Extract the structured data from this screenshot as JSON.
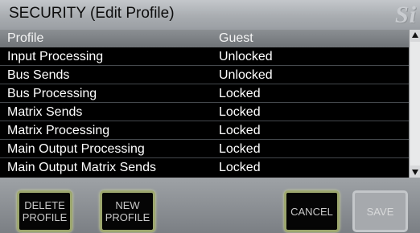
{
  "header": {
    "title": "SECURITY (Edit Profile)",
    "logo_text": "Si"
  },
  "table": {
    "header": {
      "col1": "Profile",
      "col2": "Guest"
    },
    "rows": [
      {
        "name": "Input Processing",
        "value": "Unlocked"
      },
      {
        "name": "Bus Sends",
        "value": "Unlocked"
      },
      {
        "name": "Bus Processing",
        "value": "Locked"
      },
      {
        "name": "Matrix Sends",
        "value": "Locked"
      },
      {
        "name": "Matrix Processing",
        "value": "Locked"
      },
      {
        "name": "Main Output Processing",
        "value": "Locked"
      },
      {
        "name": "Main Output Matrix Sends",
        "value": "Locked"
      }
    ]
  },
  "buttons": {
    "delete_line1": "DELETE",
    "delete_line2": "PROFILE",
    "new_line1": "NEW",
    "new_line2": "PROFILE",
    "cancel": "CANCEL",
    "save": "SAVE"
  },
  "colors": {
    "button_border": "#9ca66e",
    "header_bar": "#a9adb1",
    "row_text": "#ffffff"
  },
  "icons": {
    "scroll_up": "triangle-up",
    "scroll_down": "triangle-down"
  }
}
